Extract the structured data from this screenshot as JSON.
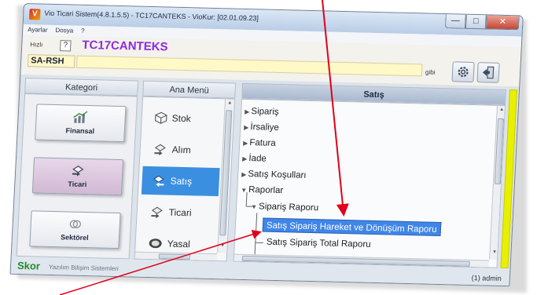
{
  "window": {
    "title": "Vio Ticari Sistem(4.8.1.5.5) - TC17CANTEKS - VioKur: [02.01.09.23]",
    "app_icon": "V",
    "buttons": {
      "minimize": "—",
      "maximize": "□",
      "close": "✕"
    }
  },
  "menubar": {
    "items": [
      "Ayarlar",
      "Dosya",
      "?"
    ]
  },
  "toolbar": {
    "hizli_label": "Hızlı",
    "help_label": "?",
    "company": "TC17CANTEKS",
    "code": "SA-RSH",
    "search_value": "",
    "search_placeholder": "",
    "gibi_label": "gibi",
    "settings_icon": "gear-icon",
    "exit_icon": "exit-door-icon"
  },
  "columns": {
    "kategori": "Kategori",
    "ana_menu": "Ana Menü",
    "satis": "Satış"
  },
  "kategori": [
    {
      "label": "Finansal",
      "icon": "finance-chart-icon",
      "active": false
    },
    {
      "label": "Ticari",
      "icon": "trade-exchange-icon",
      "active": true
    },
    {
      "label": "Sektörel",
      "icon": "sector-rings-icon",
      "active": false
    }
  ],
  "ana_menu": [
    {
      "label": "Stok",
      "icon": "box-icon",
      "active": false
    },
    {
      "label": "Alım",
      "icon": "purchase-icon",
      "active": false
    },
    {
      "label": "Satış",
      "icon": "sale-icon",
      "active": true
    },
    {
      "label": "Ticari",
      "icon": "trade-icon",
      "active": false
    },
    {
      "label": "Yasal",
      "icon": "legal-mb-icon",
      "active": false
    }
  ],
  "tree": {
    "items": [
      {
        "label": "Sipariş",
        "level": 0,
        "expanded": false
      },
      {
        "label": "İrsaliye",
        "level": 0,
        "expanded": false
      },
      {
        "label": "Fatura",
        "level": 0,
        "expanded": false
      },
      {
        "label": "İade",
        "level": 0,
        "expanded": false
      },
      {
        "label": "Satış Koşulları",
        "level": 0,
        "expanded": false
      },
      {
        "label": "Raporlar",
        "level": 0,
        "expanded": true
      },
      {
        "label": "Sipariş Raporu",
        "level": 1,
        "expanded": true
      },
      {
        "label": "Satış Sipariş Hareket ve Dönüşüm Raporu",
        "level": 2,
        "selected": true
      },
      {
        "label": "Satış Sipariş Total Raporu",
        "level": 2,
        "selected": false
      }
    ]
  },
  "status": {
    "brand": "Skor",
    "brand_sub": "Yazılım Bilişim Sistemleri",
    "user": "(1) admin"
  },
  "colors": {
    "accent_purple": "#8b2be2",
    "selection_blue": "#3f86e8",
    "brand_green": "#228a2d",
    "annotation_red": "#e0001a",
    "accent_yellow": "#e8f000"
  }
}
